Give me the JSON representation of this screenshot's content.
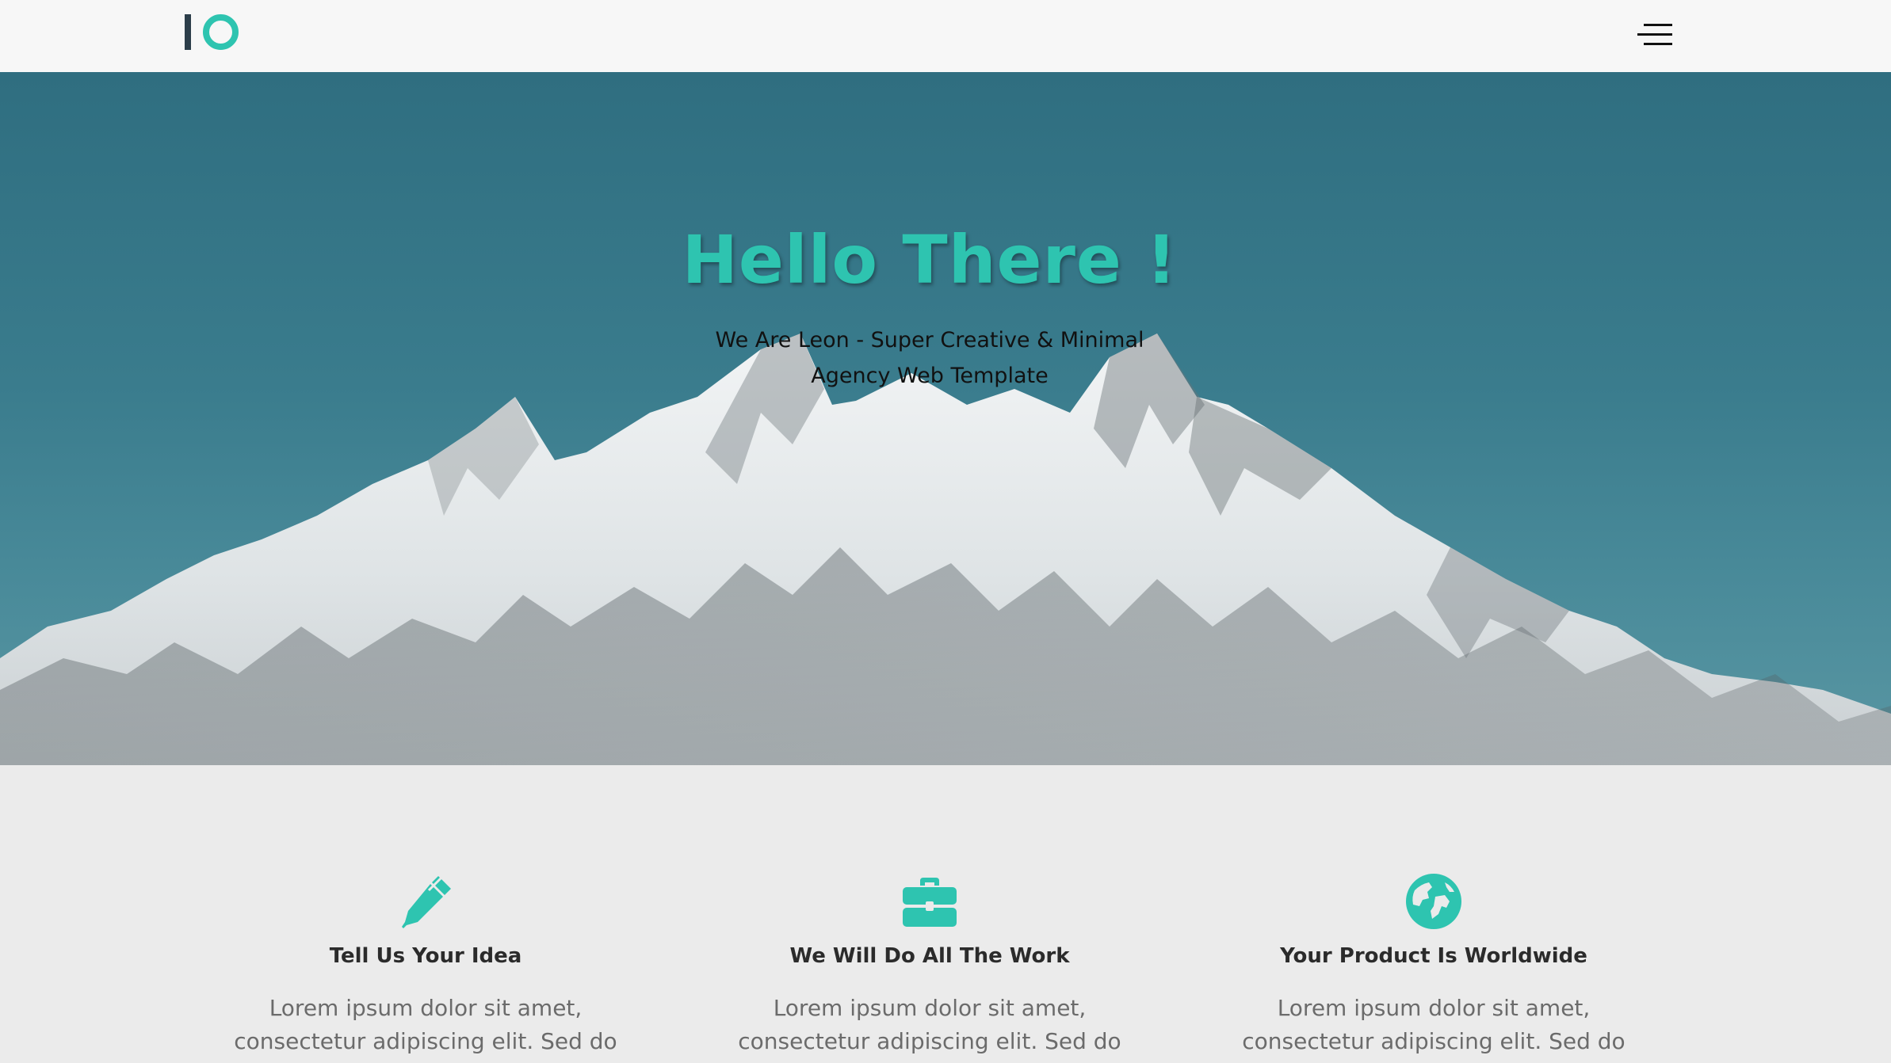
{
  "header": {
    "logo_alt": "IO",
    "menu_icon": "hamburger-menu-icon"
  },
  "hero": {
    "title": "Hello There !",
    "subtitle": "We Are Leon - Super Creative & Minimal Agency Web Template",
    "background": "snowy-mountain-photo"
  },
  "features": [
    {
      "icon": "pen-icon",
      "title": "Tell Us Your Idea",
      "text": "Lorem ipsum dolor sit amet, consectetur adipiscing elit. Sed do eiusmod tempor"
    },
    {
      "icon": "briefcase-icon",
      "title": "We Will Do All The Work",
      "text": "Lorem ipsum dolor sit amet, consectetur adipiscing elit. Sed do eiusmod tempor"
    },
    {
      "icon": "globe-icon",
      "title": "Your Product Is Worldwide",
      "text": "Lorem ipsum dolor sit amet, consectetur adipiscing elit. Sed do eiusmod tempor"
    }
  ],
  "colors": {
    "accent": "#2ec4b0",
    "header_bg": "#f7f7f7",
    "sky": "#2f6e80",
    "page_bg": "#ebebeb",
    "title_text": "#2b2b2b",
    "body_text": "#6b6b6b"
  }
}
